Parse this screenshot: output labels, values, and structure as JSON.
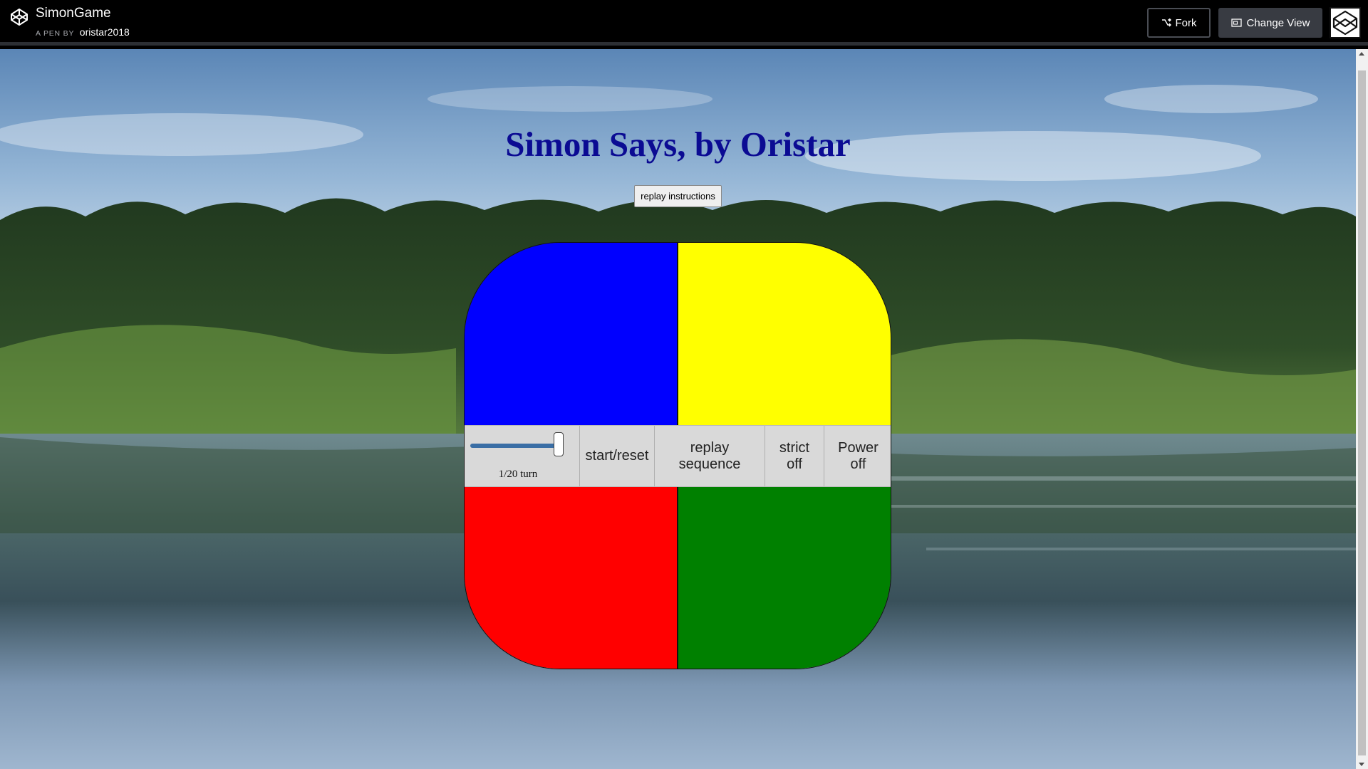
{
  "header": {
    "pen_title": "SimonGame",
    "by_prefix": "A PEN BY",
    "author": "oristar2018",
    "fork_label": "Fork",
    "change_view_label": "Change View"
  },
  "page": {
    "title": "Simon Says, by Oristar",
    "replay_instructions_label": "replay instructions"
  },
  "game": {
    "colors": {
      "top_left": "#0000ff",
      "top_right": "#ffff00",
      "bottom_left": "#ff0000",
      "bottom_right": "#008000"
    },
    "speed_slider_level": 1.0,
    "speed_label": "1/20 turn",
    "start_label": "start/reset",
    "replay_line1": "replay",
    "replay_line2": "sequence",
    "strict_line1": "strict",
    "strict_line2": "off",
    "power_line1": "Power",
    "power_line2": "off"
  }
}
